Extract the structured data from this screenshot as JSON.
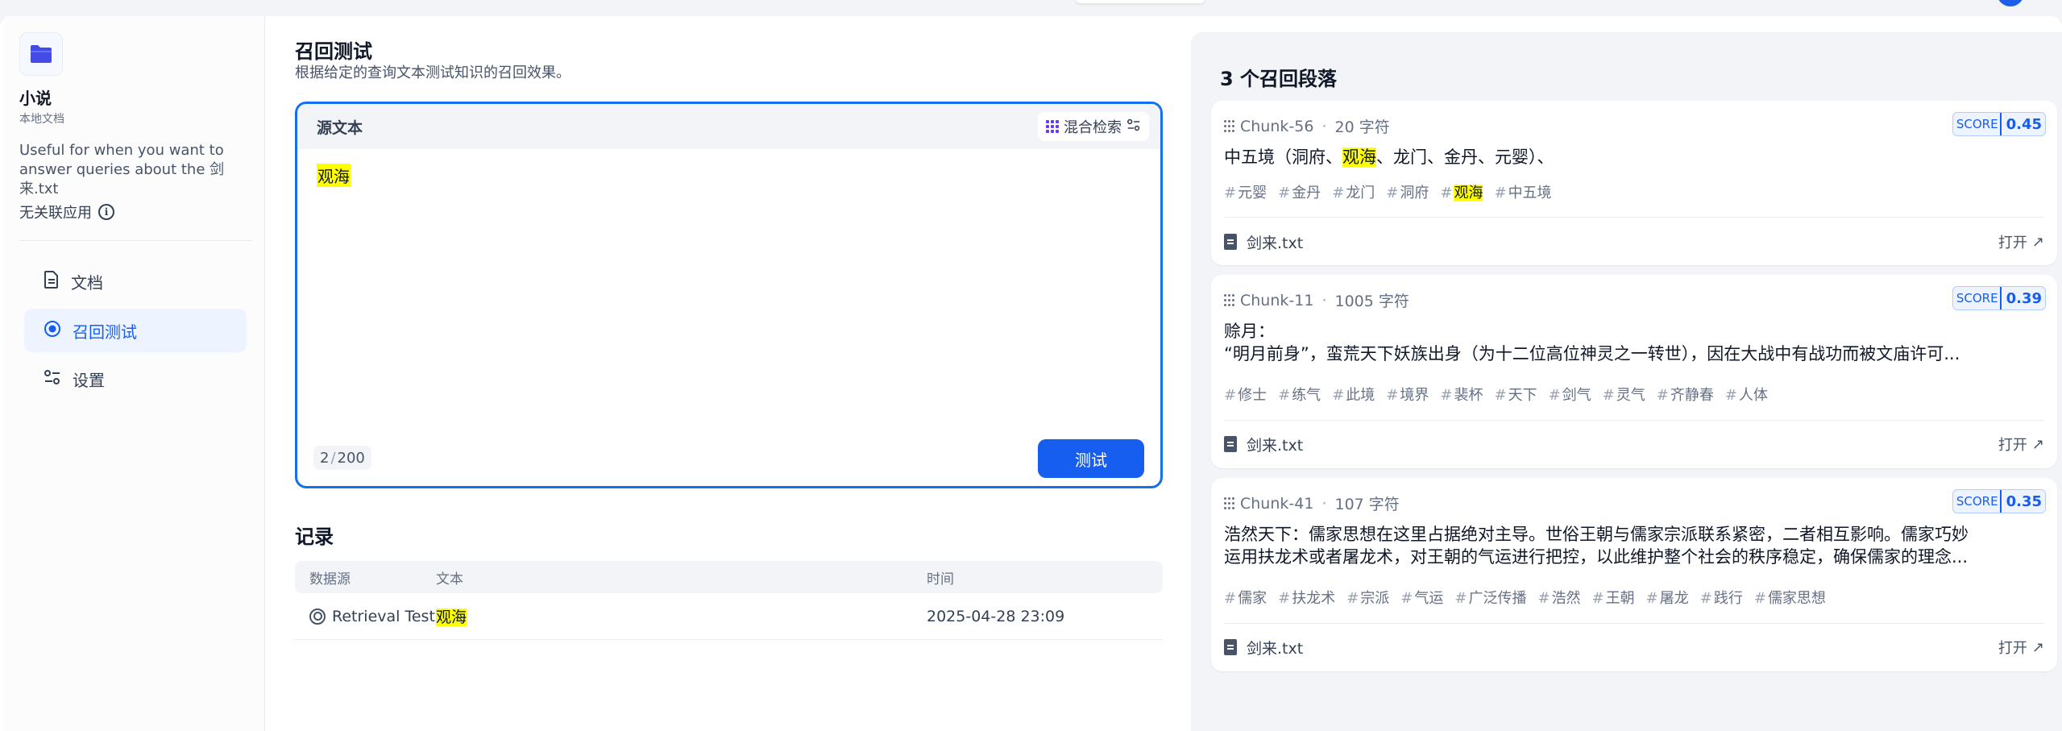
{
  "sidebar": {
    "dataset_name": "小说",
    "dataset_type": "本地文档",
    "description": "Useful for when you want to answer queries about the 剑来.txt",
    "apps_label": "无关联应用",
    "info_icon": "i",
    "nav": [
      {
        "label": "文档",
        "icon": "document-icon"
      },
      {
        "label": "召回测试",
        "icon": "target-icon"
      },
      {
        "label": "设置",
        "icon": "sliders-icon"
      }
    ]
  },
  "main": {
    "title": "召回测试",
    "subtitle": "根据给定的查询文本测试知识的召回效果。",
    "query": {
      "header": "源文本",
      "mode_label": "混合检索",
      "text": "观海",
      "count": "2",
      "max": "200",
      "test_button": "测试"
    },
    "records": {
      "title": "记录",
      "columns": [
        "数据源",
        "文本",
        "时间"
      ],
      "rows": [
        {
          "source": "Retrieval Test",
          "text": "观海",
          "time": "2025-04-28 23:09"
        }
      ]
    }
  },
  "results": {
    "title": "3 个召回段落",
    "score_label": "SCORE",
    "open_label": "打开",
    "cards": [
      {
        "chunk": "Chunk-56",
        "chars": "20 字符",
        "score": "0.45",
        "content_pre": "中五境（洞府、",
        "content_hl": "观海",
        "content_post": "、龙门、金丹、元婴）、",
        "tags": [
          "元婴",
          "金丹",
          "龙门",
          "洞府",
          "观海",
          "中五境"
        ],
        "file": "剑来.txt"
      },
      {
        "chunk": "Chunk-11",
        "chars": "1005 字符",
        "score": "0.39",
        "line1": "赊月：",
        "line2": "“明月前身”，蛮荒天下妖族出身（为十二位高位神灵之一转世），因在大战中有战功而被文庙许可...",
        "tags": [
          "修士",
          "练气",
          "此境",
          "境界",
          "裴杯",
          "天下",
          "剑气",
          "灵气",
          "齐静春",
          "人体"
        ],
        "file": "剑来.txt"
      },
      {
        "chunk": "Chunk-41",
        "chars": "107 字符",
        "score": "0.35",
        "line1": "浩然天下：儒家思想在这里占据绝对主导。世俗王朝与儒家宗派联系紧密，二者相互影响。儒家巧妙",
        "line2": "运用扶龙术或者屠龙术，对王朝的气运进行把控，以此维护整个社会的秩序稳定，确保儒家的理念...",
        "tags": [
          "儒家",
          "扶龙术",
          "宗派",
          "气运",
          "广泛传播",
          "浩然",
          "王朝",
          "屠龙",
          "践行",
          "儒家思想"
        ],
        "file": "剑来.txt"
      }
    ]
  }
}
